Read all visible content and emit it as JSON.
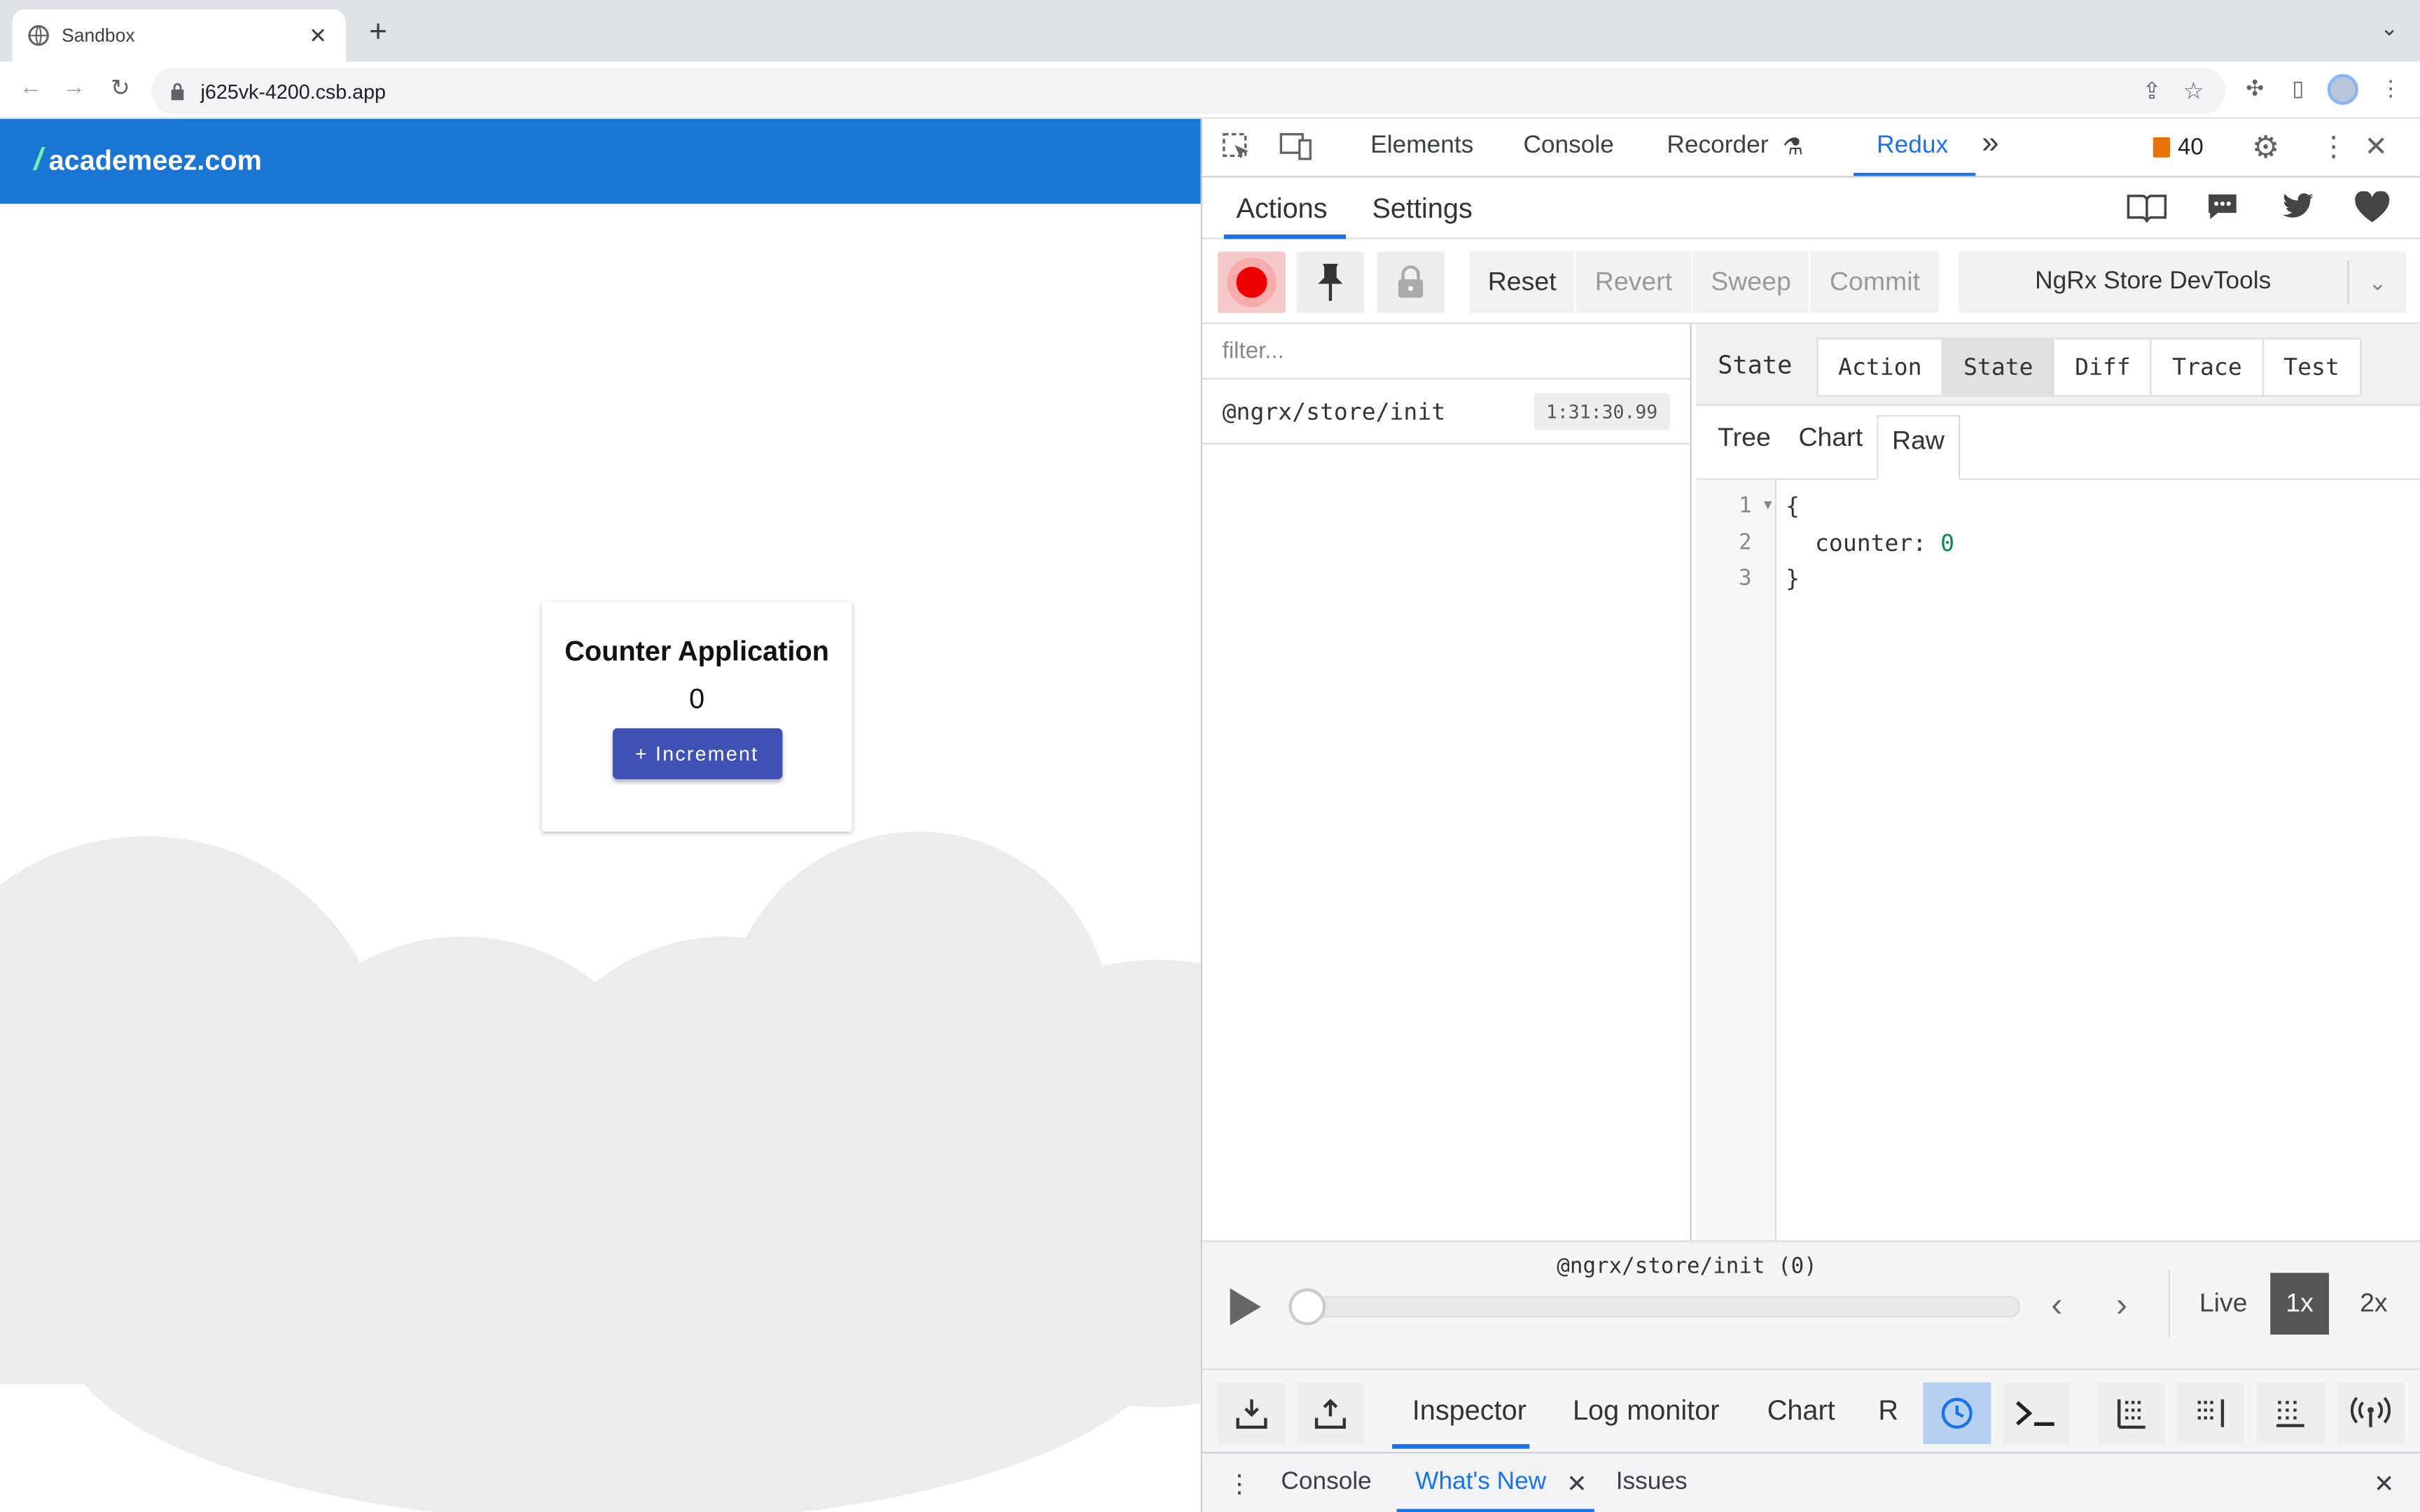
{
  "browser": {
    "tab_title": "Sandbox",
    "tab_close": "✕",
    "new_tab": "+",
    "url": "j625vk-4200.csb.app"
  },
  "page": {
    "brand_slash": "/",
    "brand": "academeez.com",
    "card_title": "Counter Application",
    "counter_value": "0",
    "increment_label": "+ Increment"
  },
  "devtools": {
    "tabs": [
      "Elements",
      "Console",
      "Recorder",
      "Redux"
    ],
    "more": "»",
    "issues_count": "40",
    "redux": {
      "nav": [
        "Actions",
        "Settings"
      ],
      "controls": [
        "Reset",
        "Revert",
        "Sweep",
        "Commit"
      ],
      "instance": "NgRx Store DevTools",
      "filter_placeholder": "filter...",
      "actions": [
        {
          "name": "@ngrx/store/init",
          "time": "1:31:30.99"
        }
      ],
      "inspector_label": "State",
      "inspector_tabs": [
        "Action",
        "State",
        "Diff",
        "Trace",
        "Test"
      ],
      "sub_tabs": [
        "Tree",
        "Chart",
        "Raw"
      ],
      "code": {
        "line_numbers": [
          "1",
          "2",
          "3"
        ],
        "line1": "{",
        "line2_key": "counter: ",
        "line2_val": "0",
        "line3": "}"
      },
      "slider_caption": "@ngrx/store/init (0)",
      "speeds": [
        "Live",
        "1x",
        "2x"
      ],
      "monitor_tabs": [
        "Inspector",
        "Log monitor",
        "Chart",
        "R"
      ]
    },
    "drawer": [
      "Console",
      "What's New",
      "Issues"
    ]
  }
}
